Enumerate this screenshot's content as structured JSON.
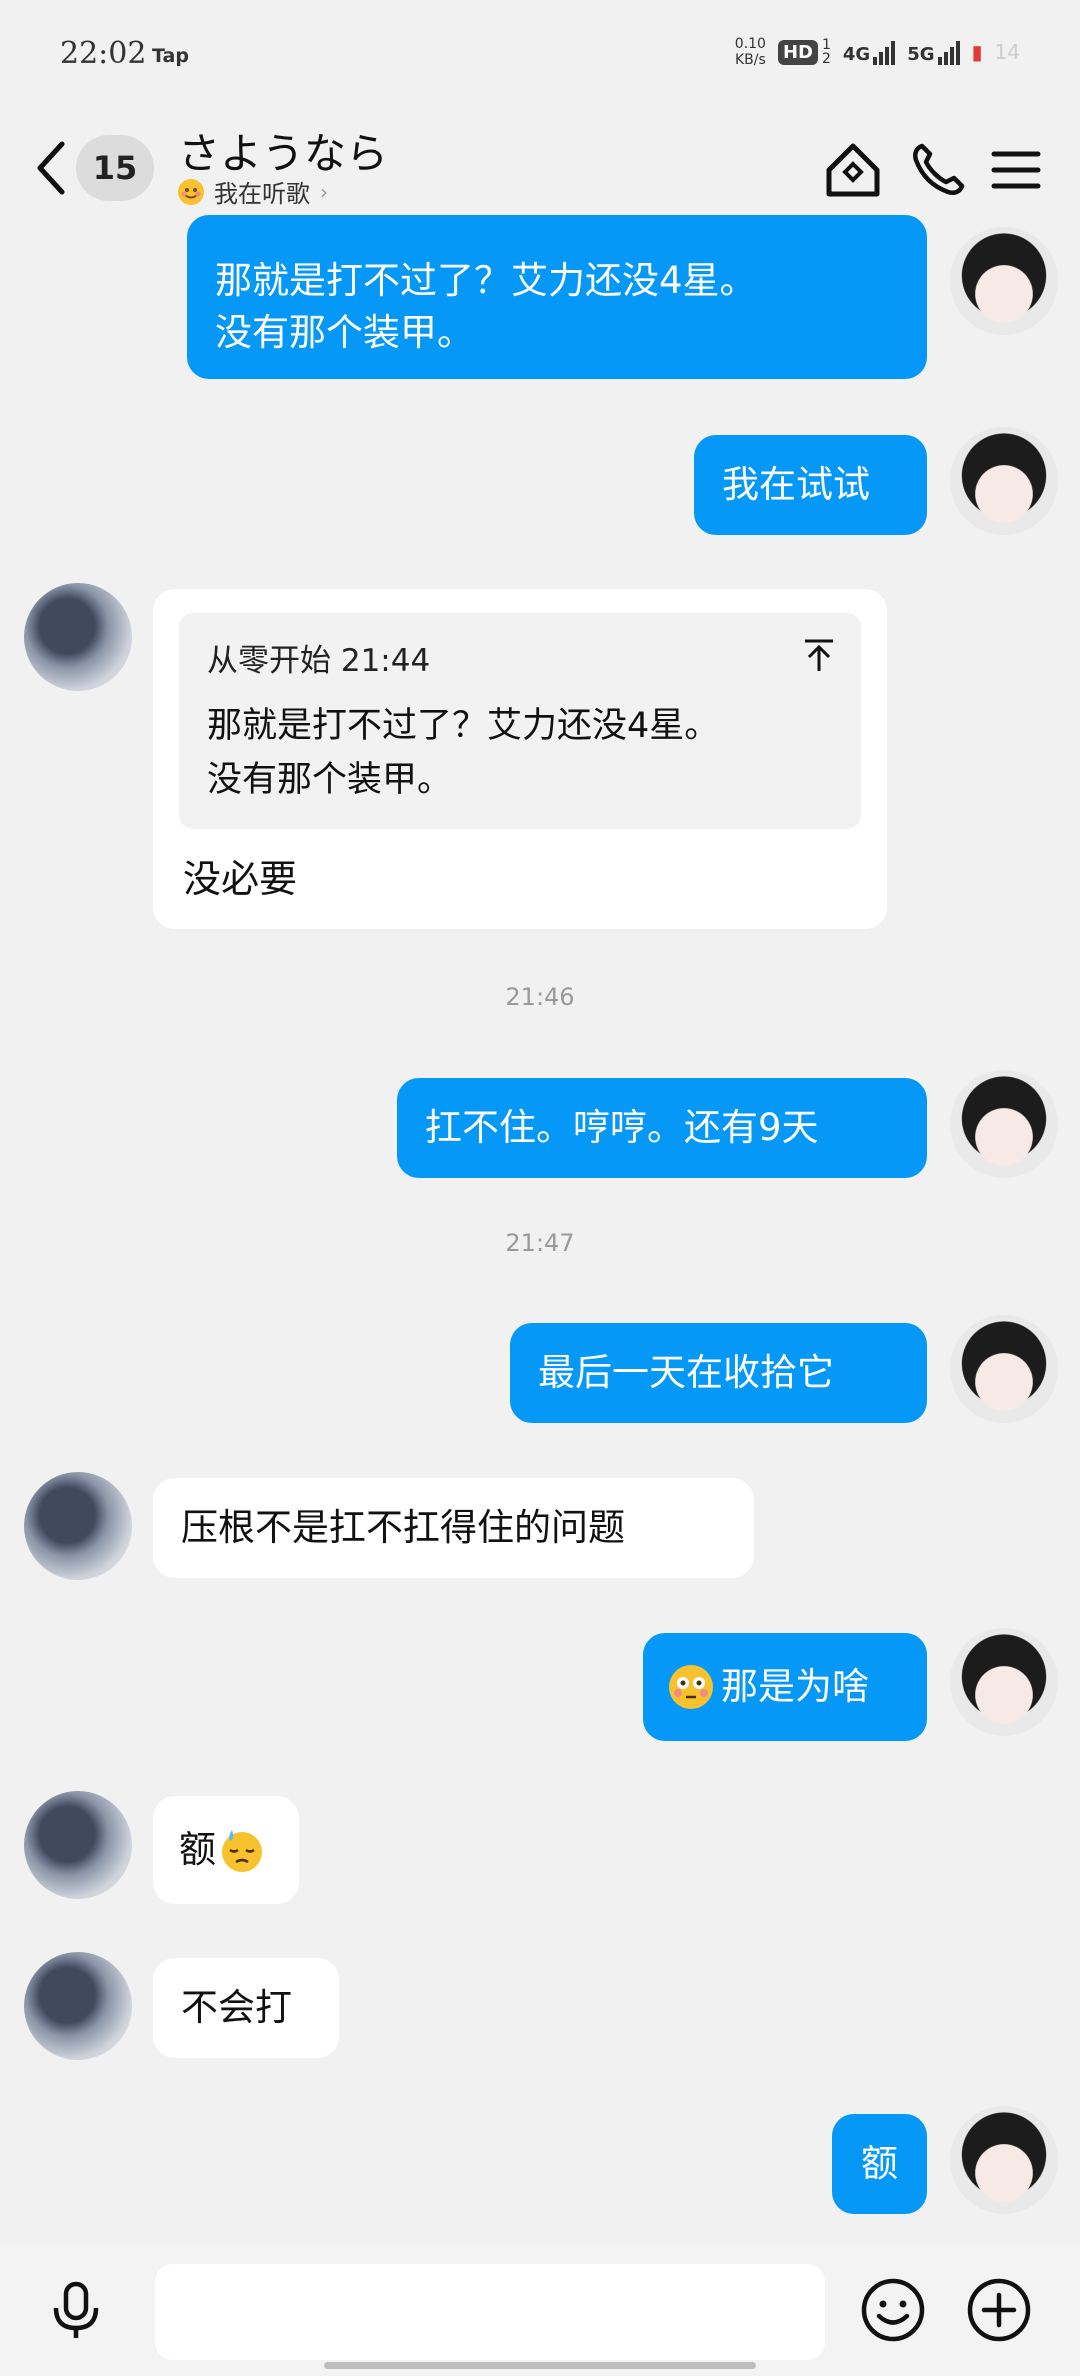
{
  "status_bar": {
    "time": "22:02",
    "app_badge": "Tap",
    "net_speed_value": "0.10",
    "net_speed_unit": "KB/s",
    "hd_label": "HD",
    "hd_sub_top": "1",
    "hd_sub_bottom": "2",
    "sim1_label": "4G",
    "sim2_label": "5G",
    "battery_level": "14"
  },
  "header": {
    "unread_count": "15",
    "title": "さようなら",
    "subtitle": "我在听歌",
    "icons": [
      "back-chevron-icon",
      "home-diamond-icon",
      "phone-icon",
      "menu-icon"
    ]
  },
  "messages": [
    {
      "side": "out",
      "text_line1": "那就是打不过了？艾力还没4星。",
      "text_line2": "没有那个装甲。"
    },
    {
      "side": "out",
      "text": "我在试试"
    },
    {
      "side": "in",
      "quote_author_time": "从零开始 21:44",
      "quote_line1": "那就是打不过了？艾力还没4星。",
      "quote_line2": "没有那个装甲。",
      "reply": "没必要"
    },
    {
      "type": "timestamp",
      "text": "21:46"
    },
    {
      "side": "out",
      "text": "扛不住。哼哼。还有9天"
    },
    {
      "type": "timestamp",
      "text": "21:47"
    },
    {
      "side": "out",
      "text": "最后一天在收拾它"
    },
    {
      "side": "in",
      "text": "压根不是扛不扛得住的问题"
    },
    {
      "side": "out",
      "text": "那是为啥",
      "emoji": "flushed-face-icon"
    },
    {
      "side": "in",
      "text": "额",
      "emoji": "downcast-sweat-face-icon"
    },
    {
      "side": "in",
      "text": "不会打"
    },
    {
      "side": "out",
      "text": "额"
    }
  ],
  "input_bar": {
    "placeholder": "",
    "icons": [
      "microphone-icon",
      "emoji-smile-icon",
      "add-plus-icon"
    ]
  },
  "colors": {
    "outgoing_bubble": "#0598f7",
    "incoming_bubble": "#ffffff",
    "background": "#f1f1f1"
  }
}
